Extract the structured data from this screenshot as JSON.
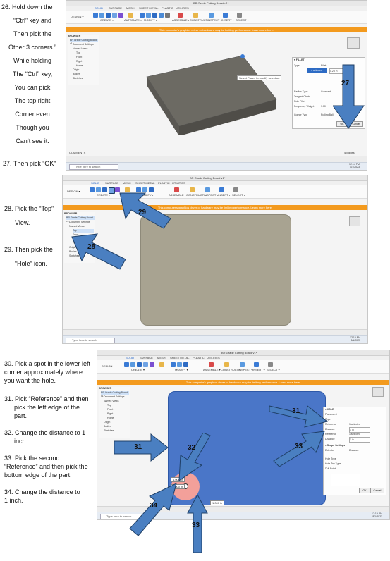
{
  "instructions": {
    "s26": [
      "26.  Hold down the",
      "“Ctrl” key and",
      "Then pick the",
      "Other 3 corners.”",
      "While holding",
      "The “Ctrl” key,",
      "You can pick",
      "The top right",
      "Corner even",
      "Though you",
      "Can’t see it."
    ],
    "s27": "27.  Then pick “OK”",
    "s28": [
      "28.  Pick the “Top”",
      "View."
    ],
    "s29": [
      "29.  Then pick the",
      "“Hole” icon."
    ],
    "s30": [
      "30. Pick a spot in the lower left",
      "corner approximately where",
      "you want the hole."
    ],
    "s31": [
      "31.  Pick “Reference” and then",
      "pick the left edge of the",
      "part."
    ],
    "s32": [
      "32.  Change the distance to    1",
      "inch."
    ],
    "s33": [
      "33.  Pick the second",
      "“Reference” and then pick the",
      "bottom edge of the part."
    ],
    "s34": [
      "34.  Change the distance to",
      "1 inch."
    ]
  },
  "callouts": {
    "a27": "27",
    "a28": "28",
    "a29": "29",
    "a31a": "31",
    "a31b": "31",
    "a32": "32",
    "a33a": "33",
    "a33b": "33",
    "a34": "34"
  },
  "app": {
    "doc_title": "BR Grade Cutting Board v1*",
    "design_label": "DESIGN ▾",
    "warning": "This computer's graphics driver or hardware may be limiting performance. Learn more here.",
    "search_placeholder": "Type here to search",
    "browser_title": "BROWSER",
    "browser_root": "BR Grade Cutting Board v1",
    "browser_items": [
      "Document Settings",
      "Named Views",
      "Top",
      "Front",
      "Right",
      "Home",
      "Origin",
      "Bodies",
      "Sketches"
    ],
    "comments": "COMMENTS",
    "menu": [
      "SOLID",
      "SURFACE",
      "MESH",
      "SHEET METAL",
      "PLASTIC",
      "UTILITIES"
    ],
    "ribbon_groups": [
      "CREATE ▾",
      "AUTOMATE ▾",
      "MODIFY ▾",
      "ASSEMBLE ▾",
      "CONSTRUCT ▾",
      "INSPECT ▾",
      "INSERT ▾",
      "SELECT ▾"
    ],
    "tooltip": "Select Faces to modify selection",
    "fillet": {
      "title": "▾ FILLET",
      "type_label": "Type",
      "type_value": "Fillet",
      "edges_label": "Edges",
      "edges_value": "4 selected",
      "radius_value": "0.25 in",
      "radius_type": "Radius Type",
      "radius_type_value": "Constant",
      "tangent": "Tangent Chain",
      "rule": "Rule Fillet",
      "setback": "Setback",
      "frequency": "Frequency Weight",
      "freq_value": "1.00",
      "corner": "Corner Type",
      "corner_value": "Rolling Ball",
      "ok": "OK",
      "cancel": "Cancel"
    },
    "hole": {
      "title": "▾ HOLE",
      "placement": "Placement",
      "type": "Type",
      "reference": "Reference",
      "ref_value": "1 selected",
      "distance": "Distance",
      "dist_value": "1 in",
      "hole_settings": "▾ Shape Settings",
      "extents": "Extents",
      "extents_value": "Distance",
      "hole_type": "Hole Type",
      "tap_type": "Hole Tap Type",
      "drill": "Drill Point",
      "ok": "OK",
      "cancel": "Cancel"
    },
    "dim1": "1.000 in",
    "dim2": "1.000 in",
    "dim3": "1.000 in",
    "time1": "12:14 PM",
    "date1": "8/1/2023",
    "time2": "12:15 PM",
    "date2": "8/1/2023",
    "time3": "12:19 PM",
    "date3": "8/1/2023",
    "selection": "4 Edges"
  },
  "colors": {
    "arrow": "#4a7fc1",
    "arrow_stroke": "#1f3f66",
    "orange": "#f39a1e",
    "board": "#6c6a63",
    "board_top": "#a8a391",
    "blue_face": "#4a76c8",
    "hole_pink": "#f3a09a"
  }
}
